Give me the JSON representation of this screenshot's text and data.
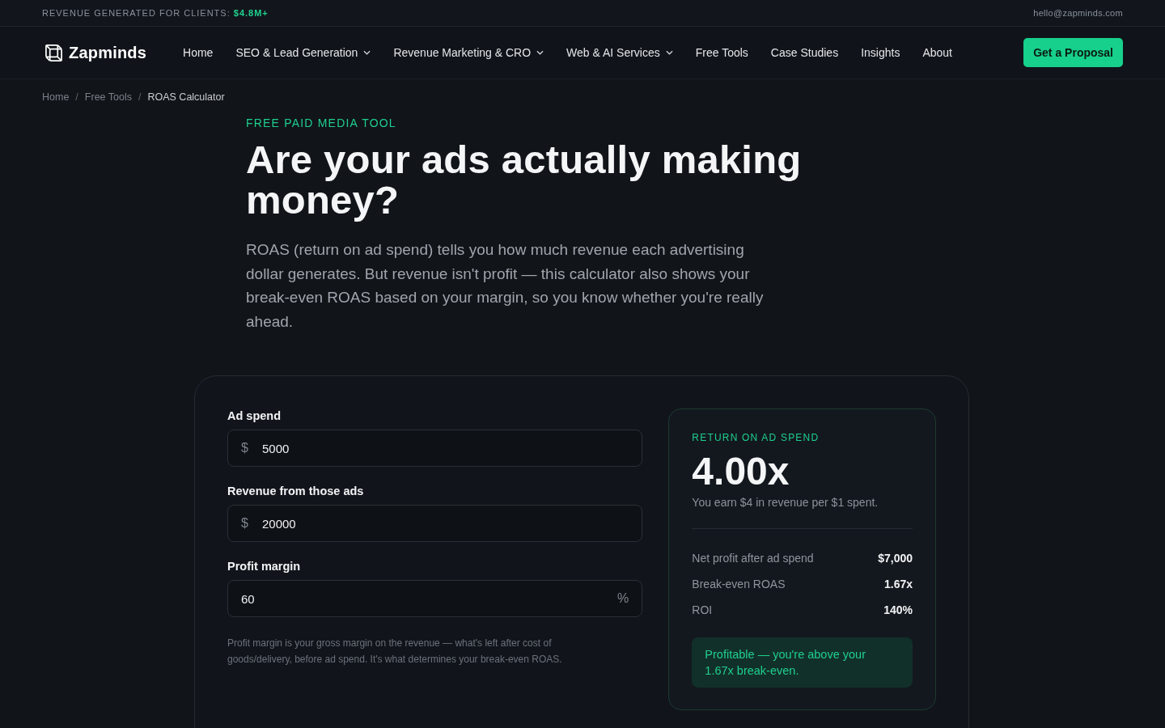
{
  "top_bar": {
    "label": "REVENUE GENERATED FOR CLIENTS:",
    "value": "$4.8M+",
    "email": "hello@zapminds.com"
  },
  "nav": {
    "logo": "Zapminds",
    "items": [
      {
        "label": "Home",
        "dropdown": false
      },
      {
        "label": "SEO & Lead Generation",
        "dropdown": true
      },
      {
        "label": "Revenue Marketing & CRO",
        "dropdown": true
      },
      {
        "label": "Web & AI Services",
        "dropdown": true
      },
      {
        "label": "Free Tools",
        "dropdown": false
      },
      {
        "label": "Case Studies",
        "dropdown": false
      },
      {
        "label": "Insights",
        "dropdown": false
      },
      {
        "label": "About",
        "dropdown": false
      }
    ],
    "cta": "Get a Proposal"
  },
  "breadcrumb": {
    "separator": "/",
    "items": [
      {
        "label": "Home",
        "current": false
      },
      {
        "label": "Free Tools",
        "current": false
      },
      {
        "label": "ROAS Calculator",
        "current": true
      }
    ]
  },
  "hero": {
    "eyebrow": "FREE PAID MEDIA TOOL",
    "title": "Are your ads actually making money?",
    "description": "ROAS (return on ad spend) tells you how much revenue each advertising dollar generates. But revenue isn't profit — this calculator also shows your break-even ROAS based on your margin, so you know whether you're really ahead."
  },
  "calculator": {
    "fields": [
      {
        "label": "Ad spend",
        "prefix": "$",
        "value": "5000"
      },
      {
        "label": "Revenue from those ads",
        "prefix": "$",
        "value": "20000"
      },
      {
        "label": "Profit margin",
        "value": "60",
        "suffix": "%"
      }
    ],
    "note": "Profit margin is your gross margin on the revenue — what's left after cost of goods/delivery, before ad spend. It's what determines your break-even ROAS.",
    "result": {
      "eyebrow": "RETURN ON AD SPEND",
      "value": "4.00x",
      "summary": "You earn $4 in revenue per $1 spent.",
      "metrics": [
        {
          "label": "Net profit after ad spend",
          "value": "$7,000"
        },
        {
          "label": "Break-even ROAS",
          "value": "1.67x"
        },
        {
          "label": "ROI",
          "value": "140%"
        }
      ],
      "status": {
        "kind": "profitable",
        "text": "Profitable — you're above your 1.67x break-even."
      }
    }
  }
}
